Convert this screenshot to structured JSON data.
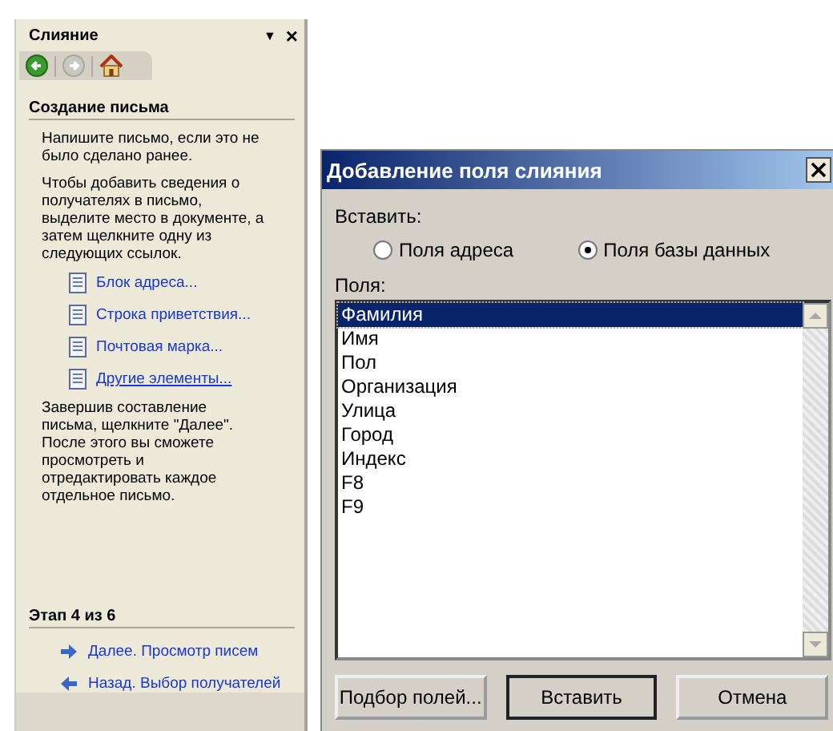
{
  "task_pane": {
    "title": "Слияние",
    "menu_glyph": "▼",
    "close_glyph": "×",
    "nav_buttons": [
      {
        "kind": "back",
        "disabled": false
      },
      {
        "kind": "forward",
        "disabled": true
      },
      {
        "kind": "home",
        "disabled": false
      }
    ],
    "section_title": "Создание письма",
    "paragraphs": [
      "Напишите письмо, если это не было сделано ранее.",
      "Чтобы добавить сведения о получателях в письмо, выделите место в документе, а затем щелкните одну из следующих ссылок."
    ],
    "links": [
      {
        "label": "Блок адреса...",
        "underlined": false
      },
      {
        "label": "Строка приветствия...",
        "underlined": false
      },
      {
        "label": "Почтовая марка...",
        "underlined": false
      },
      {
        "label": "Другие элементы...",
        "underlined": true
      }
    ],
    "closing_text": "Завершив составление письма, щелкните \"Далее\". После этого вы сможете просмотреть и отредактировать каждое отдельное письмо.",
    "step": "Этап 4 из 6",
    "step_links": [
      {
        "label": "Далее. Просмотр писем",
        "kind": "next"
      },
      {
        "label": "Назад. Выбор получателей",
        "kind": "back"
      }
    ]
  },
  "dialog": {
    "title": "Добавление поля слияния",
    "insert_label": "Вставить:",
    "options": [
      {
        "label": "Поля адреса",
        "selected": false
      },
      {
        "label": "Поля базы данных",
        "selected": true
      }
    ],
    "fields_label": "Поля:",
    "fields": [
      {
        "label": "Фамилия",
        "selected": true
      },
      {
        "label": "Имя",
        "selected": false
      },
      {
        "label": "Пол",
        "selected": false
      },
      {
        "label": "Организация",
        "selected": false
      },
      {
        "label": "Улица",
        "selected": false
      },
      {
        "label": "Город",
        "selected": false
      },
      {
        "label": "Индекс",
        "selected": false
      },
      {
        "label": "F8",
        "selected": false
      },
      {
        "label": "F9",
        "selected": false
      }
    ],
    "buttons": [
      {
        "label": "Подбор полей...",
        "default": false
      },
      {
        "label": "Вставить",
        "default": true
      },
      {
        "label": "Отмена",
        "default": false
      }
    ]
  }
}
